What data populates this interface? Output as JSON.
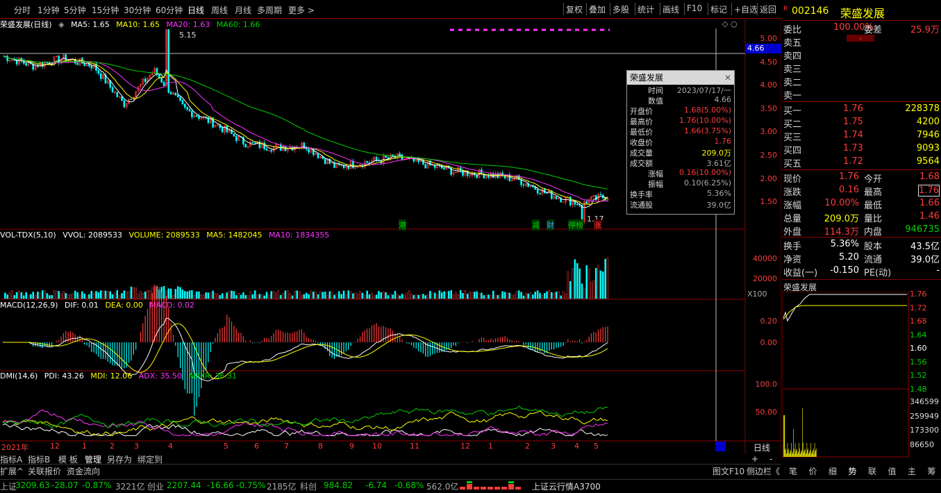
{
  "periods": [
    "分时",
    "1分钟",
    "5分钟",
    "15分钟",
    "30分钟",
    "60分钟",
    "日线",
    "周线",
    "月线",
    "多周期",
    "更多"
  ],
  "active_period": "日线",
  "tools": [
    "复权",
    "叠加",
    "多股",
    "统计",
    "画线",
    "F10",
    "标记",
    "+自选",
    "返回"
  ],
  "main": {
    "title": "荣盛发展(日线)",
    "ma5": "MA5: 1.65",
    "ma10": "MA10: 1.65",
    "ma20": "MA20: 1.63",
    "ma60": "MA60: 1.66",
    "high_mark": "5.15",
    "low_mark": "1.17",
    "cursor_price": "4.66",
    "y_ticks": [
      "5.00",
      "4.50",
      "4.00",
      "3.50",
      "3.00",
      "2.50",
      "2.00",
      "1.50"
    ],
    "events": [
      "港",
      "减",
      "财",
      "停榜",
      "涨"
    ]
  },
  "vol": {
    "title": "VOL-TDX(5,10)",
    "vvol": "VVOL: 2089533",
    "volume": "VOLUME: 2089533",
    "ma5": "MA5: 1482045",
    "ma10": "MA10: 1834355",
    "y_ticks": [
      "40000",
      "20000"
    ],
    "unit": "X100"
  },
  "macd": {
    "title": "MACD(12,26,9)",
    "dif": "DIF: 0.01",
    "dea": "DEA: 0.00",
    "macd": "MACD: 0.02",
    "y_ticks": [
      "0.20",
      "0.00"
    ]
  },
  "dmi": {
    "title": "DMI(14,6)",
    "pdi": "PDI: 43.26",
    "mdi": "MDI: 12.06",
    "adx": "ADX: 35.50",
    "adxr": "ADXR: 36.31",
    "y_ticks": [
      "100.0",
      "50.00"
    ]
  },
  "x_axis": [
    "2021年",
    "12",
    "1",
    "2",
    "3",
    "4",
    "5",
    "6",
    "7",
    "8",
    "9",
    "10",
    "11",
    "12",
    "1",
    "2",
    "3",
    "4",
    "5",
    "6",
    "7"
  ],
  "x_axis_right": "日线",
  "tooltip": {
    "title": "荣盛发展",
    "rows": [
      {
        "k": "时间",
        "v": "2023/07/17/一",
        "c": "gray"
      },
      {
        "k": "数值",
        "v": "4.66",
        "c": "gray"
      },
      {
        "k": "开盘价",
        "v": "1.68(5.00%)",
        "c": "red"
      },
      {
        "k": "最高价",
        "v": "1.76(10.00%)",
        "c": "red"
      },
      {
        "k": "最低价",
        "v": "1.66(3.75%)",
        "c": "red"
      },
      {
        "k": "收盘价",
        "v": "1.76",
        "c": "red"
      },
      {
        "k": "成交量",
        "v": "209.0万",
        "c": "yellow"
      },
      {
        "k": "成交额",
        "v": "3.61亿",
        "c": "gray"
      },
      {
        "k": "涨幅",
        "v": "0.16(10.00%)",
        "c": "red"
      },
      {
        "k": "振幅",
        "v": "0.10(6.25%)",
        "c": "gray"
      },
      {
        "k": "换手率",
        "v": "5.36%",
        "c": "gray"
      },
      {
        "k": "流通股",
        "v": "39.0亿",
        "c": "gray"
      }
    ]
  },
  "right_panel": {
    "code": "002146",
    "name": "荣盛发展",
    "weibi_label": "委比",
    "weibi": "100.00%",
    "weicha_label": "委差",
    "weicha": "25.9万",
    "sells": [
      "卖五",
      "卖四",
      "卖三",
      "卖二",
      "卖一"
    ],
    "buys": [
      {
        "label": "买一",
        "price": "1.76",
        "vol": "228378"
      },
      {
        "label": "买二",
        "price": "1.75",
        "vol": "4200"
      },
      {
        "label": "买三",
        "price": "1.74",
        "vol": "7946"
      },
      {
        "label": "买四",
        "price": "1.73",
        "vol": "9093"
      },
      {
        "label": "买五",
        "price": "1.72",
        "vol": "9564"
      }
    ],
    "quotes": [
      {
        "a": "现价",
        "b": "1.76",
        "c_label": "今开",
        "c": "1.68"
      },
      {
        "a": "涨跌",
        "b": "0.16",
        "c_label": "最高",
        "c": "1.76"
      },
      {
        "a": "涨幅",
        "b": "10.00%",
        "c_label": "最低",
        "c": "1.66"
      },
      {
        "a": "总量",
        "b": "209.0万",
        "c_label": "量比",
        "c": "1.46"
      },
      {
        "a": "外盘",
        "b": "114.3万",
        "c_label": "内盘",
        "c": "946735"
      }
    ],
    "stats": [
      {
        "a": "换手",
        "b": "5.36%",
        "c_label": "股本",
        "c": "43.5亿"
      },
      {
        "a": "净资",
        "b": "5.20",
        "c_label": "流通",
        "c": "39.0亿"
      },
      {
        "a": "收益(一)",
        "b": "-0.150",
        "c_label": "PE(动)",
        "c": "-"
      }
    ],
    "mini_title": "荣盛发展",
    "mini_prices": [
      "1.76",
      "1.72",
      "1.68",
      "1.64",
      "1.60",
      "1.56",
      "1.52",
      "1.48"
    ],
    "mini_vols": [
      "346599",
      "259949",
      "173300",
      "86650"
    ],
    "tabs": [
      "笔",
      "价",
      "细",
      "势",
      "联",
      "值",
      "主",
      "筹"
    ]
  },
  "bottom_tabs_row1": [
    "指标A",
    "指标B",
    "模 板",
    "管理",
    "另存为",
    "绑定到"
  ],
  "bottom_tabs_row2": [
    "扩展^",
    "关联报价",
    "资金流向"
  ],
  "bottom_right": [
    "图文F10",
    "侧边栏《"
  ],
  "status": {
    "sh_label": "上证",
    "sh": "3209.63",
    "sh_chg": "-28.07",
    "sh_pct": "-0.87%",
    "sh_amt": "3221亿",
    "cy_label": "创业",
    "cy": "2207.44",
    "cy_chg": "-16.66",
    "cy_pct": "-0.75%",
    "cy_amt": "2185亿",
    "kc_label": "科创",
    "kc": "984.82",
    "kc_chg": "-6.74",
    "kc_pct": "-0.68%",
    "kc_amt": "562.0亿",
    "cloud": "上证云行情A3700"
  },
  "chart_data": {
    "type": "line",
    "title": "荣盛发展(日线)",
    "x": [
      "2021年",
      "12",
      "1",
      "2",
      "3",
      "4",
      "5",
      "6",
      "7",
      "8",
      "9",
      "10",
      "11",
      "12",
      "1",
      "2",
      "3",
      "4",
      "5",
      "6",
      "7"
    ],
    "series": [
      {
        "name": "close",
        "values": [
          4.6,
          4.4,
          4.55,
          4.4,
          3.6,
          4.3,
          3.5,
          3.2,
          2.8,
          2.7,
          2.75,
          2.3,
          2.4,
          2.5,
          2.35,
          2.2,
          2.15,
          2.05,
          1.75,
          1.55,
          1.7
        ]
      }
    ],
    "ylim": [
      1.2,
      5.2
    ]
  }
}
